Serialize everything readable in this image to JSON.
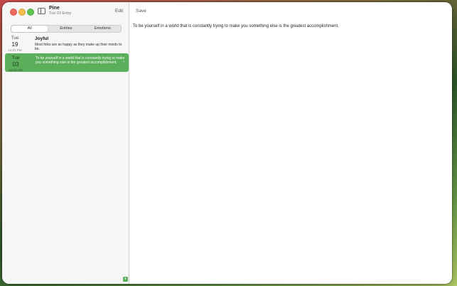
{
  "window": {
    "app_name": "Pine",
    "subtitle": "Tue 03 Entry"
  },
  "toolbar": {
    "edit_label": "Edit",
    "save_label": "Save"
  },
  "filter": {
    "segments": [
      "All",
      "Entries",
      "Emotions"
    ],
    "selected": "All"
  },
  "entries": [
    {
      "weekday": "Tue",
      "day": "19",
      "time": "12:01 PM",
      "title": "Joyful",
      "preview": "Most folks are as happy as they make up their minds to be.",
      "selected": false
    },
    {
      "weekday": "Tue",
      "day": "03",
      "time": "12:12 AM",
      "title": "",
      "preview": "To be yourself in a world that is constantly trying to make you something else is the greatest accomplishment.",
      "selected": true
    }
  ],
  "editor": {
    "content": "To be yourself in a world that is constantly trying to make you something else is the greatest accomplishment."
  },
  "colors": {
    "accent": "#5bae5a"
  },
  "icons": {
    "sidebar_toggle": "sidebar-toggle-icon",
    "row_chevron": "chevron-right-icon",
    "bottom_toggle": "chevron-down-icon"
  }
}
